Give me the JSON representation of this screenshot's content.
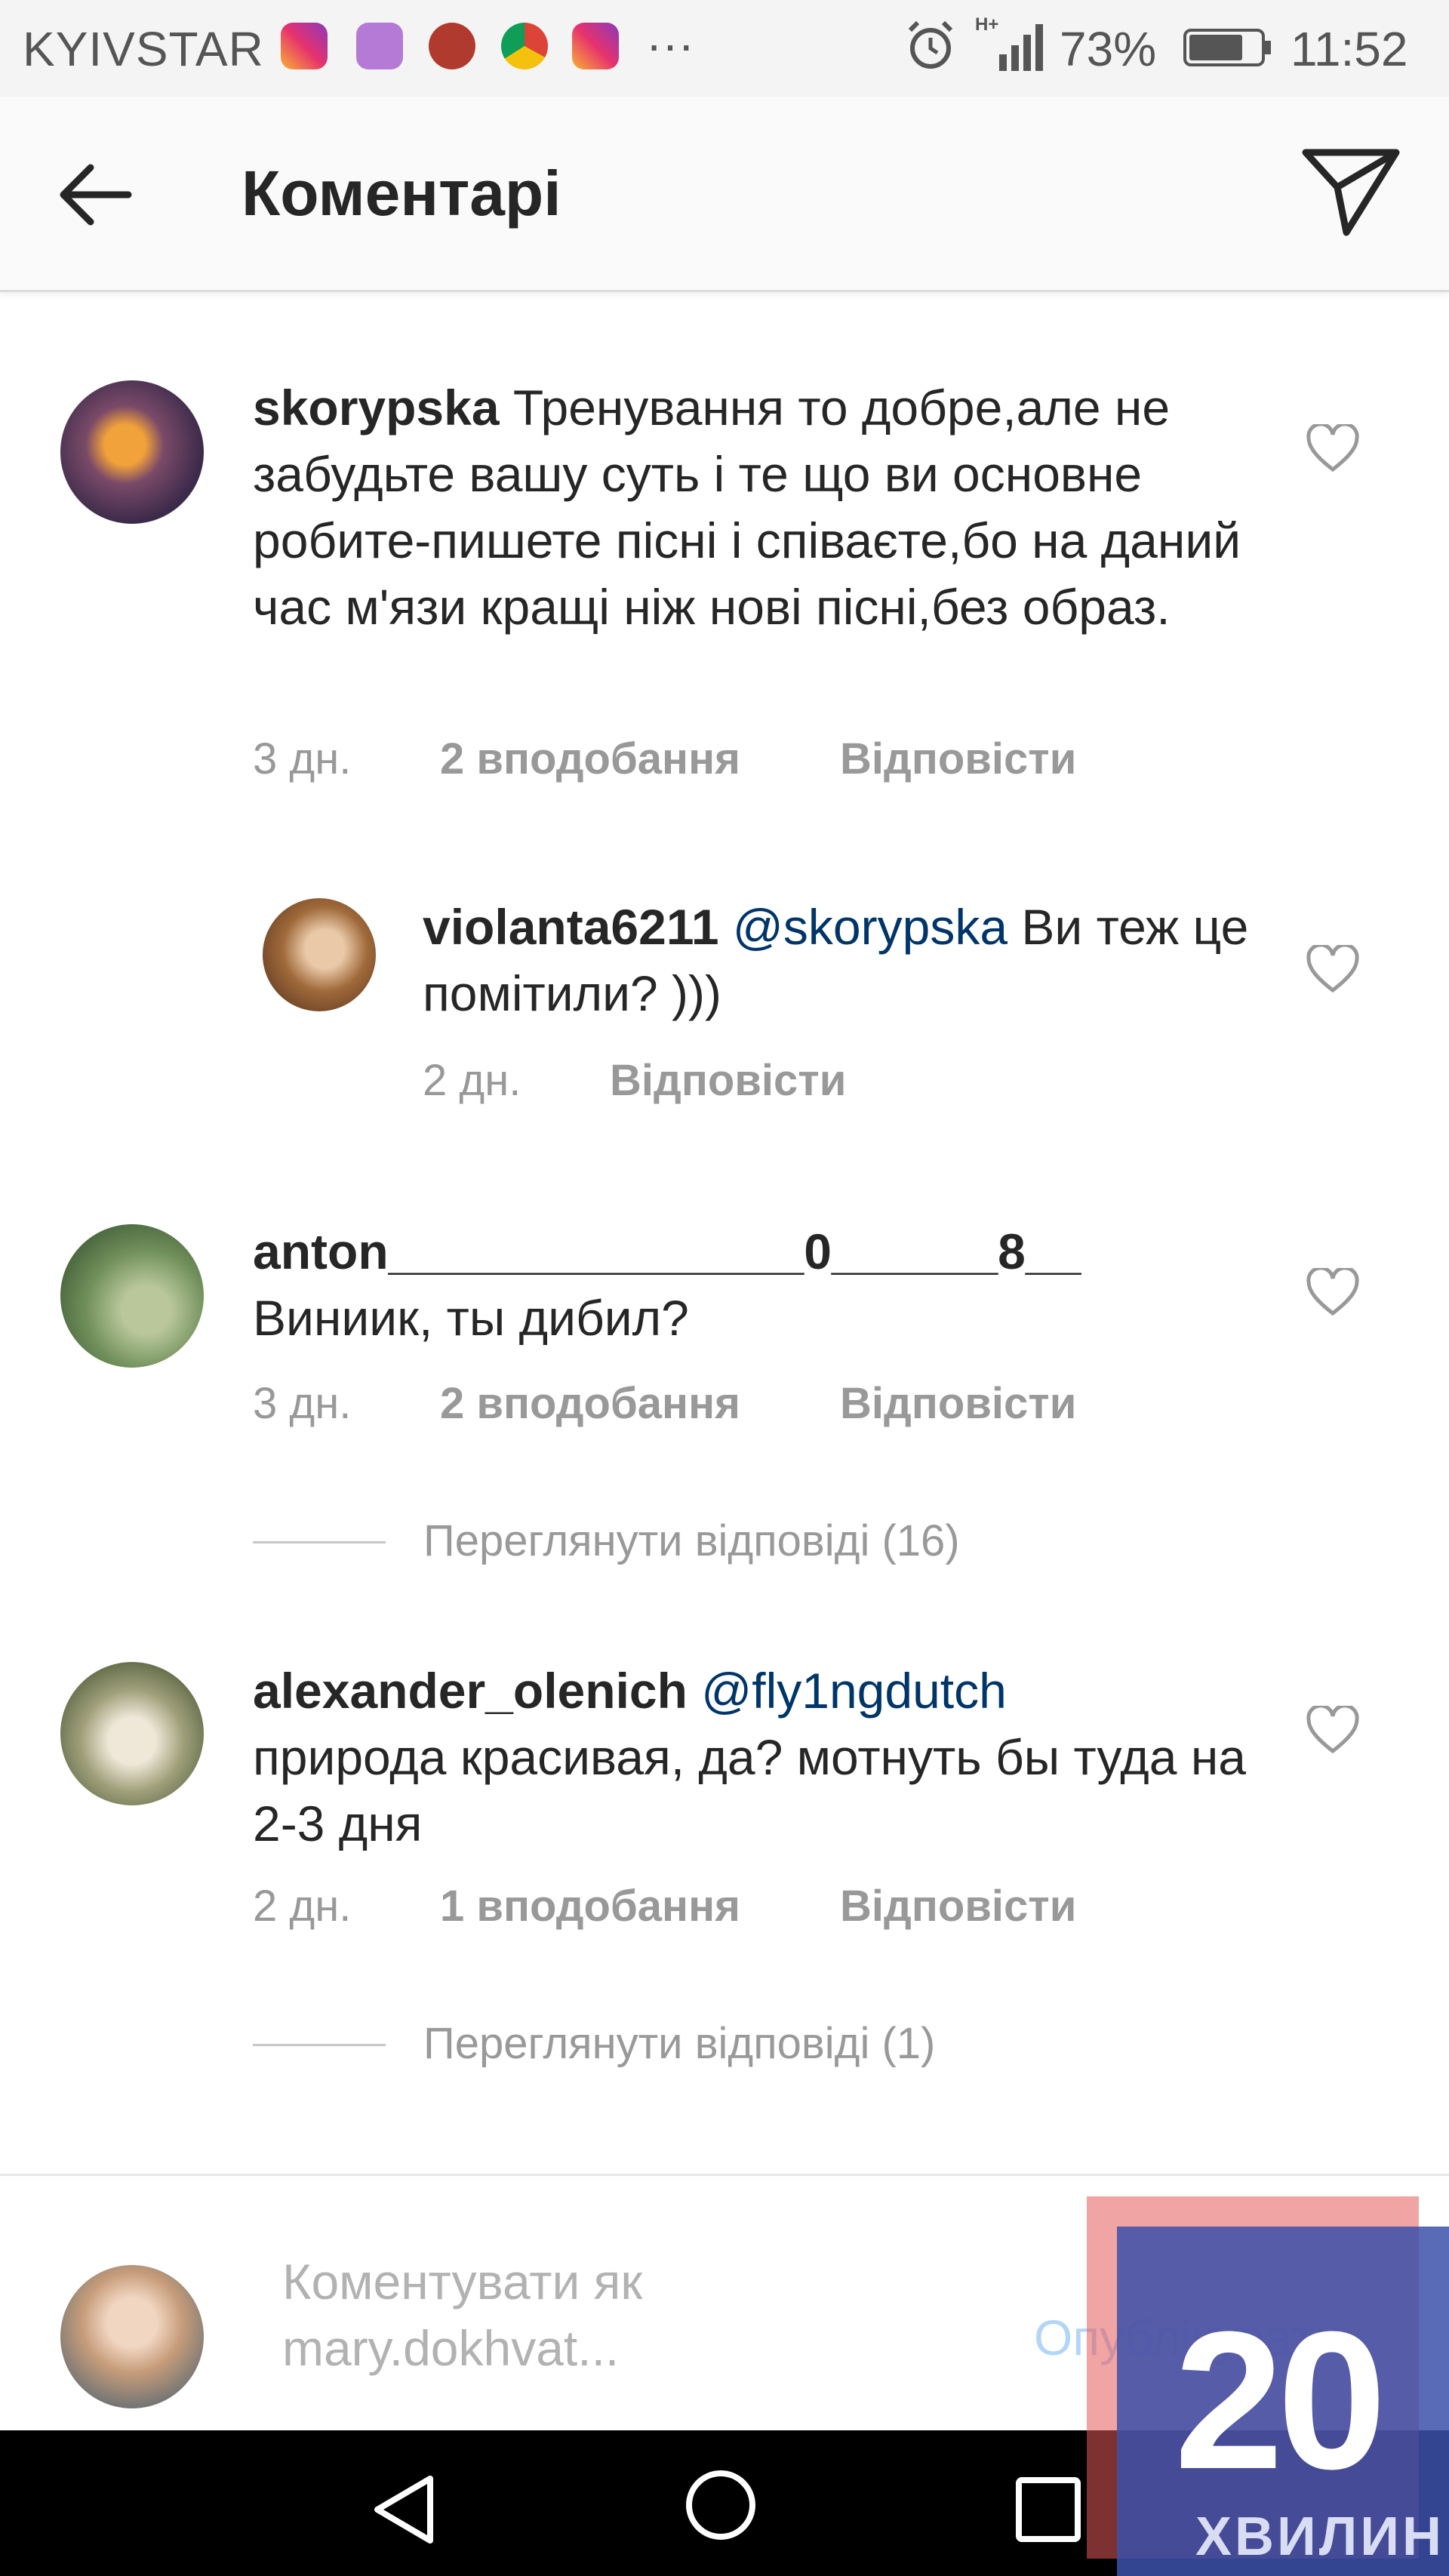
{
  "status_bar": {
    "carrier": "KYIVSTAR",
    "dots": "···",
    "battery_pct": "73%",
    "time": "11:52",
    "icons": [
      "instagram-icon",
      "gallery-icon",
      "app-icon",
      "chrome-icon",
      "instagram-icon"
    ]
  },
  "header": {
    "title": "Коментарі",
    "back_icon": "arrow-left-icon",
    "share_icon": "send-icon"
  },
  "comments": [
    {
      "username": "skorypska",
      "text": " Тренування то добре,але не забудьте вашу суть і те що ви основне робите-пишете пісні і співаєте,бо на даний час м'язи кращі ніж нові пісні,без образ.",
      "mention": "",
      "time": "3 дн.",
      "likes": "2 вподобання",
      "reply": "Відповісти"
    },
    {
      "username": "violanta6211",
      "mention": " @skorypska",
      "text": "  Ви теж це помітили? )))",
      "time": "2 дн.",
      "likes": "",
      "reply": "Відповісти"
    },
    {
      "username": "anton_______________0______8__",
      "text": "Виниик, ты дибил?",
      "mention": "",
      "time": "3 дн.",
      "likes": "2 вподобання",
      "reply": "Відповісти",
      "view_replies": "Переглянути відповіді (16)"
    },
    {
      "username": "alexander_olenich",
      "mention": " @fly1ngdutch",
      "text": "природа красивая, да? мотнуть бы туда на 2-3 дня",
      "time": "2 дн.",
      "likes": "1 вподобання",
      "reply": "Відповісти",
      "view_replies": "Переглянути відповіді (1)"
    }
  ],
  "input": {
    "placeholder": "Коментувати як mary.dokhvat...",
    "publish": "Опублікувати"
  },
  "watermark": {
    "number": "20",
    "word": "ХВИЛИН"
  },
  "colors": {
    "mention": "#003569",
    "meta": "#999999",
    "publish_disabled": "#b4d6f6"
  }
}
